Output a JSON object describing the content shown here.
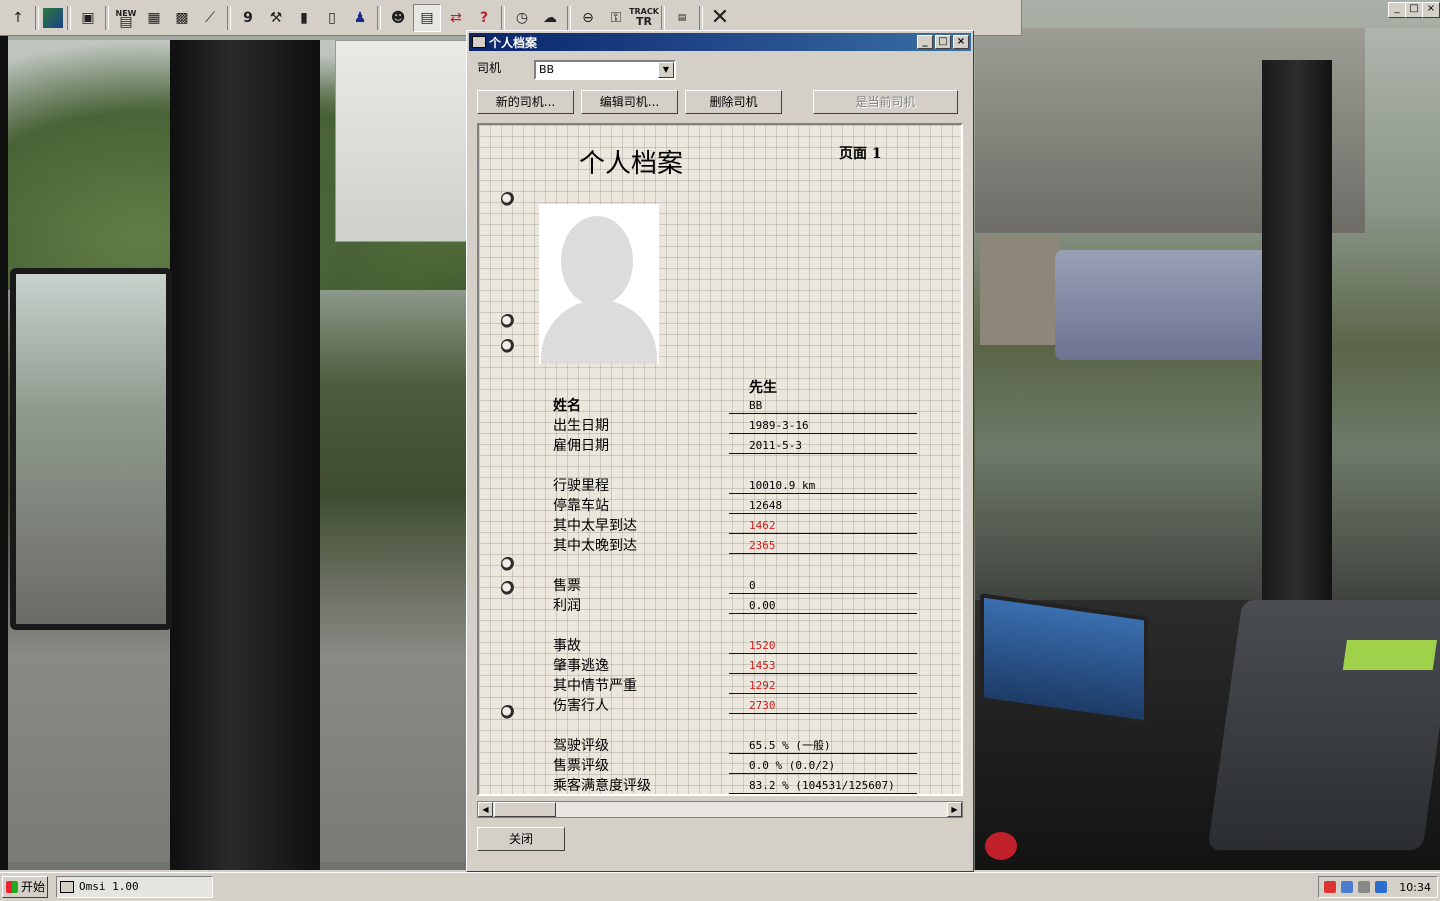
{
  "toolbar": {
    "icons": [
      "up-arrow-icon",
      "map-icon",
      "save-icon",
      "new-icon",
      "bus-front-icon",
      "bus-side-icon",
      "tools-icon",
      "route-number-icon",
      "wrench-icon",
      "bus-icon",
      "door-icon",
      "driver-icon",
      "person-icon",
      "timetable-icon",
      "swap-icon",
      "help-icon",
      "clock-icon",
      "weather-icon",
      "camera-icon",
      "ai-icon",
      "track-icon",
      "time-icon",
      "close-icon"
    ],
    "new_label": "NEW",
    "track_label_top": "TRACK",
    "track_label_bottom": "TR"
  },
  "dialog": {
    "title": "个人档案",
    "driver_label": "司机",
    "driver_selected": "BB",
    "buttons": {
      "new_driver": "新的司机...",
      "edit_driver": "编辑司机...",
      "delete_driver": "删除司机",
      "set_current": "是当前司机"
    },
    "close_label": "关闭"
  },
  "profile": {
    "heading": "个人档案",
    "page_label": "页面 1",
    "salutation": "先生",
    "rows": [
      {
        "label": "姓名",
        "value": "BB",
        "bold": true,
        "red": false
      },
      {
        "label": "出生日期",
        "value": "1989-3-16",
        "bold": false,
        "red": false
      },
      {
        "label": "雇佣日期",
        "value": "2011-5-3",
        "bold": false,
        "red": false
      },
      {
        "label": "行驶里程",
        "value": "10010.9 km",
        "bold": false,
        "red": false
      },
      {
        "label": "停靠车站",
        "value": "12648",
        "bold": false,
        "red": false
      },
      {
        "label": "其中太早到达",
        "value": "1462",
        "bold": false,
        "red": true
      },
      {
        "label": "其中太晚到达",
        "value": "2365",
        "bold": false,
        "red": true
      },
      {
        "label": "售票",
        "value": "0",
        "bold": false,
        "red": false
      },
      {
        "label": "利润",
        "value": "0.00",
        "bold": false,
        "red": false
      },
      {
        "label": "事故",
        "value": "1520",
        "bold": false,
        "red": true
      },
      {
        "label": "肇事逃逸",
        "value": "1453",
        "bold": false,
        "red": true
      },
      {
        "label": "其中情节严重",
        "value": "1292",
        "bold": false,
        "red": true
      },
      {
        "label": "伤害行人",
        "value": "2730",
        "bold": false,
        "red": true
      },
      {
        "label": "驾驶评级",
        "value": "65.5 % (一般)",
        "bold": false,
        "red": false
      },
      {
        "label": "售票评级",
        "value": "0.0 % (0.0/2)",
        "bold": false,
        "red": false
      },
      {
        "label": "乘客满意度评级",
        "value": "83.2 % (104531/125607)",
        "bold": false,
        "red": false
      }
    ]
  },
  "taskbar": {
    "start_label": "开始",
    "task_label": "Omsi 1.00",
    "clock": "10:34"
  },
  "colors": {
    "titlebar_start": "#0a246a",
    "titlebar_end": "#3a6ea5",
    "red_value": "#d21c1c",
    "paper": "#ece7dc"
  }
}
